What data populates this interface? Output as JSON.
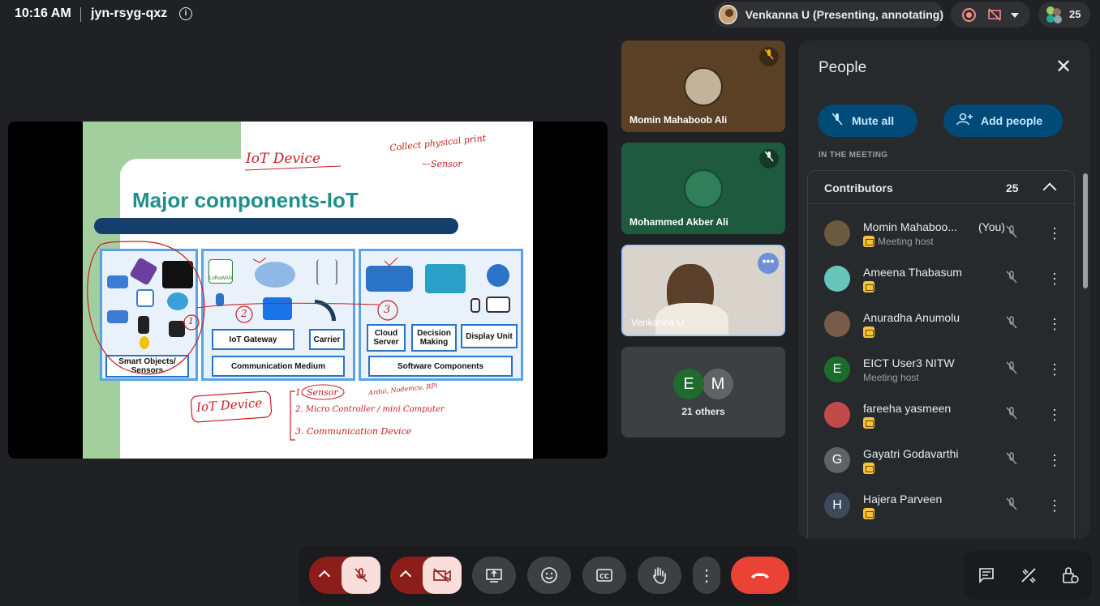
{
  "topbar": {
    "time": "10:16 AM",
    "meeting_code": "jyn-rsyg-qxz",
    "info_icon": "info-icon",
    "presenting_label": "Venkanna U (Presenting, annotating)",
    "participant_count": "25"
  },
  "slide": {
    "title": "Major components-IoT",
    "labels": {
      "smart_objects": "Smart Objects/ Sensors",
      "iot_gateway": "IoT Gateway",
      "carrier": "Carrier",
      "communication_medium": "Communication Medium",
      "cloud_server": "Cloud Server",
      "decision_making": "Decision Making",
      "display_unit": "Display Unit",
      "software_components": "Software Components",
      "lorawan": "LoRaWAN"
    },
    "annotations": {
      "iot_device_top": "IoT Device",
      "collect": "Collect physical print",
      "sensor": "—Sensor",
      "one": "1",
      "two": "2",
      "three": "3",
      "iot_device_bottom": "IoT Device",
      "list1": "1. Sensor",
      "list2": "2. Micro Controller / mini Computer",
      "list2_note": "Ardui, Nodemcu, RPi",
      "list3": "3. Communication Device"
    }
  },
  "tiles": [
    {
      "name": "Momin Mahaboob Ali"
    },
    {
      "name": "Mohammed Akber Ali"
    },
    {
      "name": "Venkanna U"
    }
  ],
  "others": {
    "e1": "E",
    "e2": "M",
    "label": "21 others"
  },
  "people_panel": {
    "title": "People",
    "mute_all": "Mute all",
    "add_people": "Add people",
    "in_meeting": "IN THE MEETING",
    "contributors_label": "Contributors",
    "contributors_count": "25",
    "participants": [
      {
        "name": "Momin Mahaboo...",
        "you": "(You)",
        "role": "Meeting host",
        "initial": "",
        "color": "#6b5a3e"
      },
      {
        "name": "Ameena Thabasum",
        "you": "",
        "role": "",
        "initial": "",
        "color": "#67c6b9"
      },
      {
        "name": "Anuradha Anumolu",
        "you": "",
        "role": "",
        "initial": "",
        "color": "#7a5a48"
      },
      {
        "name": "EICT User3 NITW",
        "you": "",
        "role": "Meeting host",
        "initial": "E",
        "color": "#1e6b2e"
      },
      {
        "name": "fareeha yasmeen",
        "you": "",
        "role": "",
        "initial": "",
        "color": "#c04a4a"
      },
      {
        "name": "Gayatri Godavarthi",
        "you": "",
        "role": "",
        "initial": "G",
        "color": "#5f6368"
      },
      {
        "name": "Hajera Parveen",
        "you": "",
        "role": "",
        "initial": "H",
        "color": "#3c4a5a"
      }
    ]
  },
  "controls": {
    "mic": "mic-off",
    "cam": "camera-off",
    "present": "present-icon",
    "emoji": "emoji-icon",
    "captions": "captions-icon",
    "hand": "raise-hand-icon",
    "more": "more-icon",
    "hangup": "hangup-icon"
  }
}
